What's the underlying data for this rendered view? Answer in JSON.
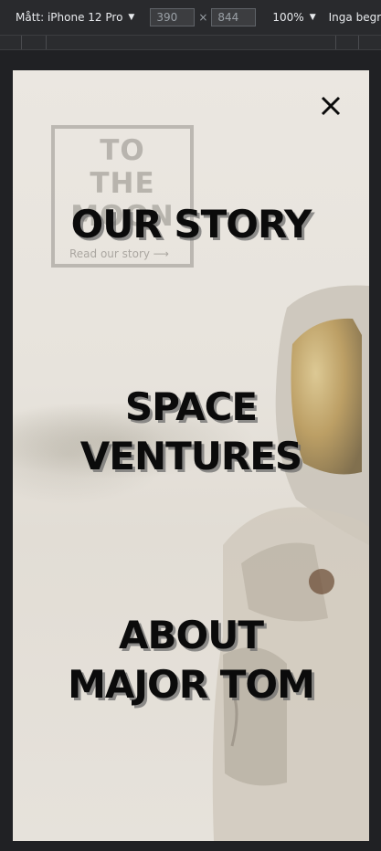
{
  "devtools": {
    "device_label": "Mått: iPhone 12 Pro",
    "width_value": "390",
    "height_value": "844",
    "times_sign": "×",
    "zoom_label": "100%",
    "throttle_label": "Inga begränsni"
  },
  "page": {
    "logo_line1": "TO",
    "logo_line2": "THE",
    "logo_line3": "MOON",
    "read_link": "Read our story ⟶",
    "close_icon": "close-icon",
    "menu": [
      {
        "line1": "OUR STORY",
        "line2": ""
      },
      {
        "line1": "SPACE",
        "line2": "VENTURES"
      },
      {
        "line1": "ABOUT",
        "line2": "MAJOR TOM"
      }
    ]
  },
  "colors": {
    "menu_text": "#0b0b0b",
    "overlay": "#e9e5df",
    "devtools_bg": "#292a2d"
  }
}
